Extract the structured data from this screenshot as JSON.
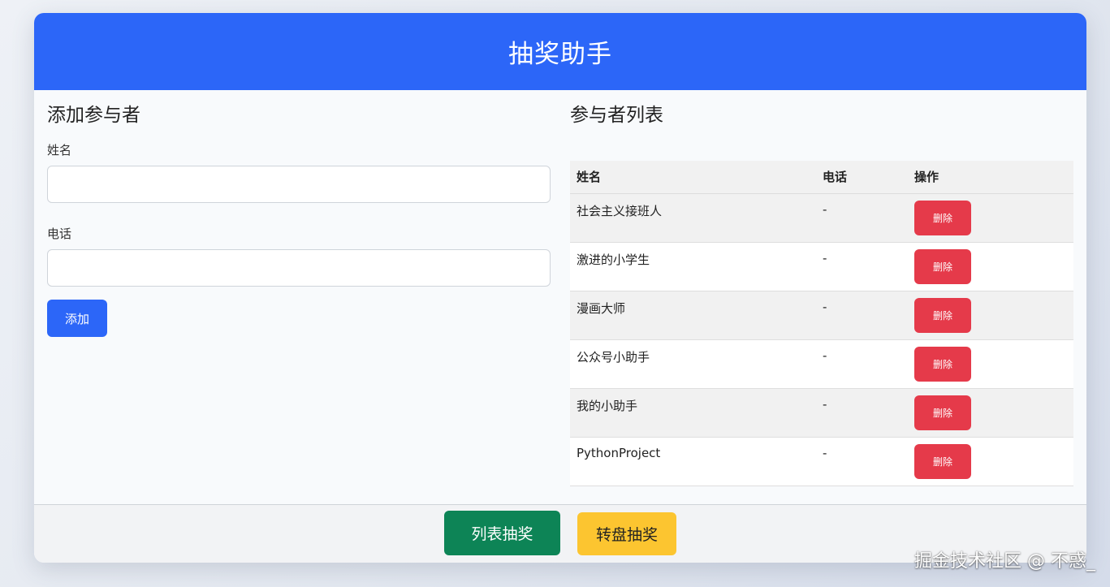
{
  "header": {
    "title": "抽奖助手"
  },
  "add_panel": {
    "title": "添加参与者",
    "name_label": "姓名",
    "name_value": "",
    "phone_label": "电话",
    "phone_value": "",
    "add_button": "添加"
  },
  "list_panel": {
    "title": "参与者列表",
    "columns": [
      "姓名",
      "电话",
      "操作"
    ],
    "rows": [
      {
        "name": "社会主义接班人",
        "phone": "-",
        "action": "删除"
      },
      {
        "name": "激进的小学生",
        "phone": "-",
        "action": "删除"
      },
      {
        "name": "漫画大师",
        "phone": "-",
        "action": "删除"
      },
      {
        "name": "公众号小助手",
        "phone": "-",
        "action": "删除"
      },
      {
        "name": "我的小助手",
        "phone": "-",
        "action": "删除"
      },
      {
        "name": "PythonProject",
        "phone": "-",
        "action": "删除"
      }
    ]
  },
  "footer": {
    "list_draw_button": "列表抽奖",
    "wheel_draw_button": "转盘抽奖"
  },
  "watermark": "掘金技术社区 @ 不惑_",
  "colors": {
    "primary": "#2c66f8",
    "danger": "#e53a4a",
    "success": "#0d8456",
    "warning": "#fcc530"
  }
}
